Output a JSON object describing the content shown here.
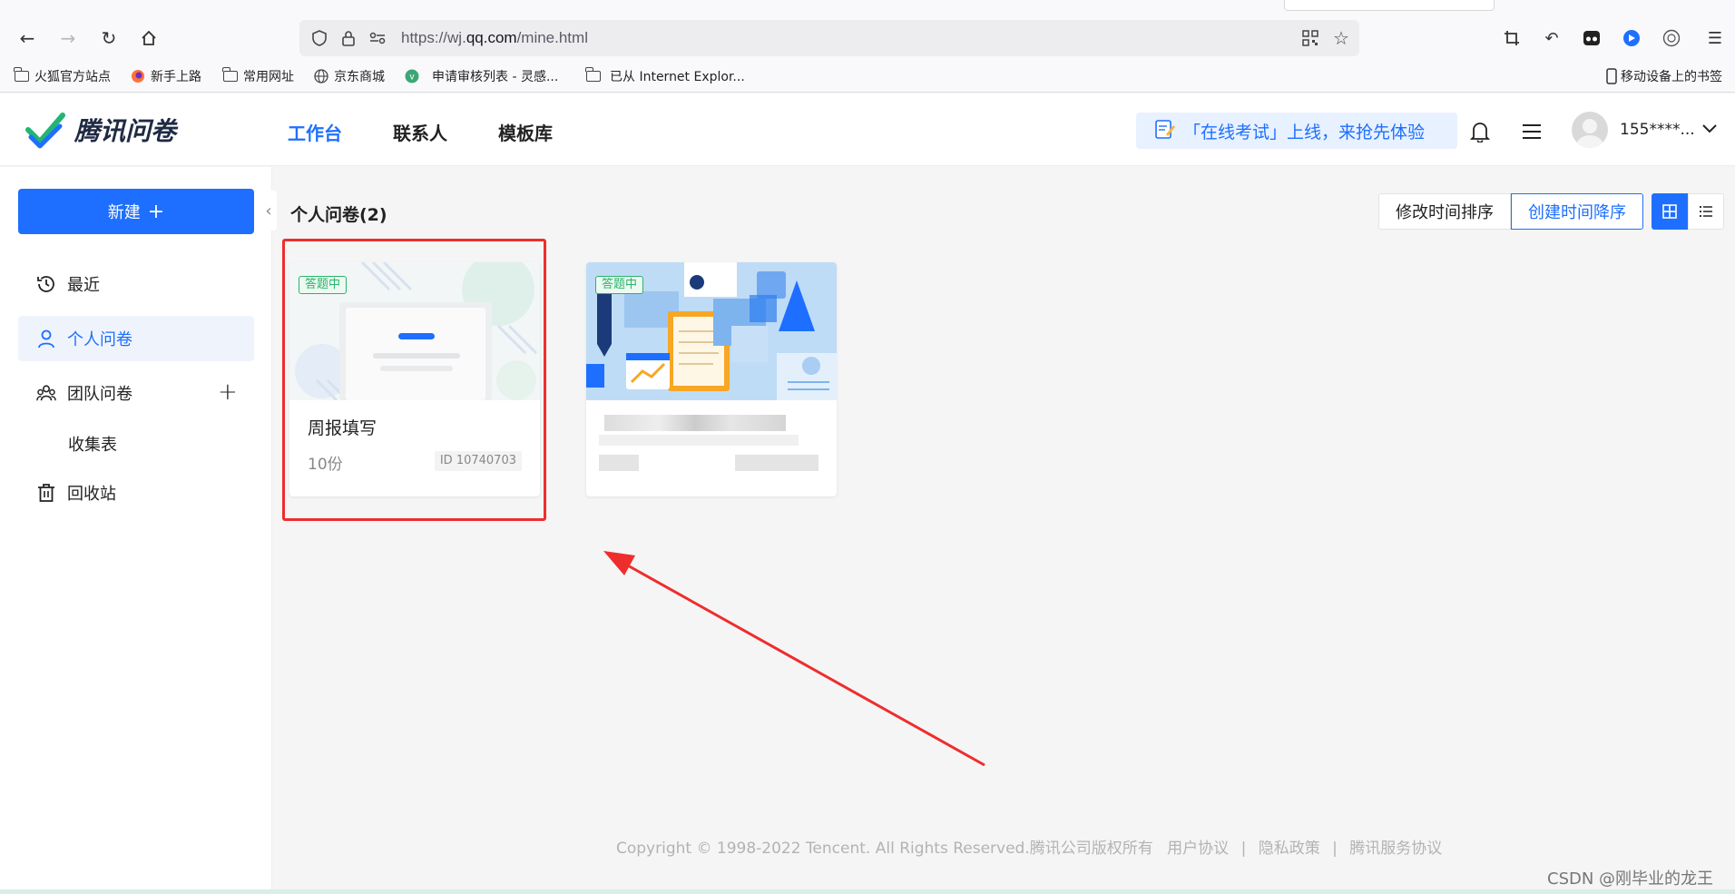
{
  "browser": {
    "url_prefix": "https://wj.",
    "url_domain": "qq.com",
    "url_path": "/mine.html",
    "bookmarks": [
      {
        "label": "火狐官方站点",
        "icon": "folder-icon"
      },
      {
        "label": "新手上路",
        "icon": "firefox-icon"
      },
      {
        "label": "常用网址",
        "icon": "folder-icon"
      },
      {
        "label": "京东商城",
        "icon": "globe-icon"
      },
      {
        "label": "申请审核列表 - 灵感...",
        "icon": "vue-icon"
      },
      {
        "label": "已从 Internet Explor...",
        "icon": "folder-icon"
      }
    ],
    "mobile_bookmarks": "移动设备上的书签"
  },
  "header": {
    "logo_text": "腾讯问卷",
    "nav": [
      "工作台",
      "联系人",
      "模板库"
    ],
    "active_nav": "工作台",
    "promo": "「在线考试」上线，来抢先体验",
    "username": "155****..."
  },
  "sidebar": {
    "new_button": "新建",
    "items": [
      {
        "label": "最近",
        "icon": "clock-icon"
      },
      {
        "label": "个人问卷",
        "icon": "user-icon",
        "active": true
      },
      {
        "label": "团队问卷",
        "icon": "team-icon"
      },
      {
        "label": "收集表",
        "icon": ""
      },
      {
        "label": "回收站",
        "icon": "trash-icon"
      }
    ]
  },
  "main": {
    "section_title": "个人问卷(2)",
    "sort_options": [
      "修改时间排序",
      "创建时间降序"
    ],
    "selected_sort": "创建时间降序",
    "view_mode": "grid",
    "cards": [
      {
        "status": "答题中",
        "title": "周报填写",
        "count": "10份",
        "id": "ID  10740703"
      },
      {
        "status": "答题中",
        "title": "",
        "count": "",
        "id": ""
      }
    ]
  },
  "footer": {
    "copyright": "Copyright © 1998-2022 Tencent. All Rights Reserved.腾讯公司版权所有",
    "links": [
      "用户协议",
      "隐私政策",
      "腾讯服务协议"
    ]
  },
  "watermark": "CSDN @刚毕业的龙王",
  "colors": {
    "accent": "#1e6fff",
    "status_green": "#2bb36b",
    "annotation_red": "#ee2d2d"
  }
}
